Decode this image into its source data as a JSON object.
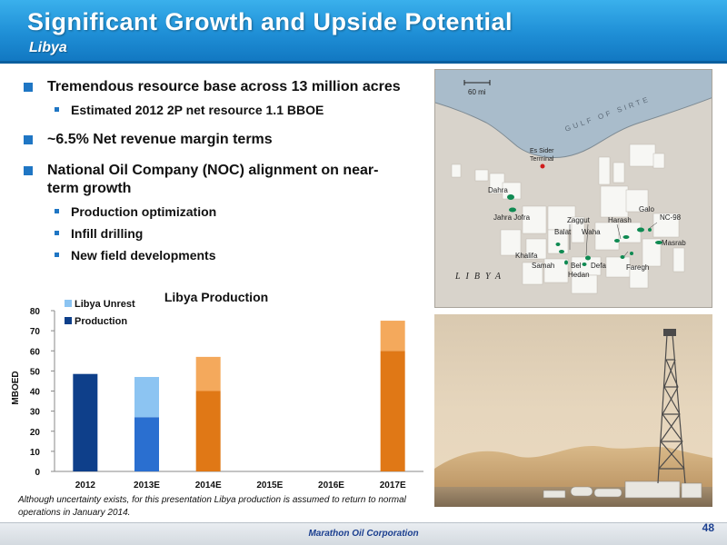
{
  "header": {
    "title": "Significant Growth and Upside Potential",
    "subtitle": "Libya"
  },
  "bullets": {
    "b1": "Tremendous resource base across 13 million acres",
    "b1_sub1": "Estimated 2012 2P net resource 1.1 BBOE",
    "b2": "~6.5% Net revenue margin terms",
    "b3_line1": "National Oil Company (NOC) alignment on near-",
    "b3_line2": "term growth",
    "b3_sub1": "Production optimization",
    "b3_sub2": "Infill drilling",
    "b3_sub3": "New field developments"
  },
  "map": {
    "scale": "60 mi",
    "sea": "GULF OF SIRTE",
    "country": "LIBYA",
    "places": {
      "es_sider": "Es Sider",
      "terminal": "Terminal",
      "dahra": "Dahra",
      "jahra": "Jahra Jofra",
      "zaggut": "Zaggut",
      "harash": "Harash",
      "nc98": "NC-98",
      "galo": "Galo",
      "balat": "Balat",
      "waha": "Waha",
      "khalifa": "Khalifa",
      "masrab": "Masrab",
      "samah": "Samah",
      "bel": "Bel",
      "defa": "Defa",
      "faregh": "Faregh",
      "hedan": "Hedan"
    }
  },
  "chart_data": {
    "type": "bar",
    "title": "Libya Production",
    "ylabel": "MBOED",
    "xlabel": "",
    "categories": [
      "2012",
      "2013E",
      "2014E",
      "2015E",
      "2016E",
      "2017E"
    ],
    "ylim": [
      0,
      80
    ],
    "yticks": [
      0,
      10,
      20,
      30,
      40,
      50,
      60,
      70,
      80
    ],
    "stacked": true,
    "grid": false,
    "legend_position": "top-left",
    "series": [
      {
        "name": "Production",
        "values": [
          48.5,
          27,
          40,
          0,
          0,
          60
        ]
      },
      {
        "name": "Libya Unrest",
        "values": [
          0,
          20,
          17,
          0,
          0,
          15
        ]
      }
    ],
    "colors": {
      "2012": "#0e3f8a",
      "2013E": "#2a6fd0",
      "2013E_unrest": "#8cc4f2",
      "2014E": "#e07816",
      "2014E_unrest": "#f4a95c",
      "2017E": "#e07816",
      "2017E_unrest": "#f4a95c",
      "legend_unrest": "#8cc4f2",
      "legend_production": "#0e3f8a"
    }
  },
  "footnote": "Although uncertainty exists, for this presentation Libya production is assumed to return to normal operations in January 2014.",
  "footer": {
    "company": "Marathon Oil Corporation",
    "page": "48"
  }
}
